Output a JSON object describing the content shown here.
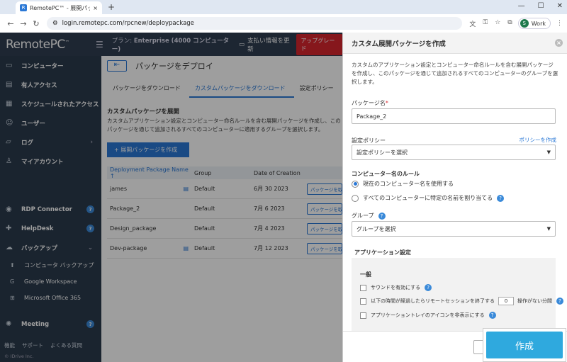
{
  "browser": {
    "tab_title": "RemotePC™ - 展開パッケージ",
    "new_tab": "+",
    "url_host": "login.remotepc.com",
    "url_path": "/rpcnew/deploypackage",
    "profile_initial": "S",
    "profile_label": "Work"
  },
  "topbar": {
    "logo": "RemotePC",
    "logo_tm": "™",
    "plan_label": "プラン: ",
    "plan_value": "Enterprise (4000 コンピューター)",
    "billing_label": "支払い情報を更新",
    "upgrade_label": "アップグレード"
  },
  "sidebar": {
    "items": [
      {
        "label": "コンピューター",
        "icon": "monitor-icon"
      },
      {
        "label": "有人アクセス",
        "icon": "attended-icon"
      },
      {
        "label": "スケジュールされたアクセス",
        "icon": "calendar-icon"
      },
      {
        "label": "ユーザー",
        "icon": "users-icon"
      },
      {
        "label": "ログ",
        "icon": "folder-icon"
      },
      {
        "label": "マイアカウント",
        "icon": "user-icon"
      }
    ],
    "products": [
      {
        "label": "RDP Connector"
      },
      {
        "label": "HelpDesk"
      },
      {
        "label": "バックアップ"
      }
    ],
    "backup_sub": [
      {
        "label": "コンピュータ バックアップ"
      },
      {
        "label": "Google Workspace"
      },
      {
        "label": "Microsoft Office 365"
      }
    ],
    "meeting": "Meeting",
    "footer": [
      "機能",
      "サポート",
      "よくある質問"
    ],
    "copyright": "© IDrive Inc."
  },
  "main": {
    "back_arrow": "⇤",
    "title": "パッケージをデプロイ",
    "tabs": [
      "パッケージをダウンロード",
      "カスタムパッケージをダウンロード",
      "設定ポリシー"
    ],
    "section_title": "カスタムパッケージを展開",
    "section_desc": "カスタムアプリケーション設定とコンピューター命名ルールを含む展開パッケージを作成し、このパッケージを通じて追加されるすべてのコンピューターに適用するグループを選択します。",
    "create_button": "+ 展開パッケージを作成",
    "columns": [
      "Deployment Package Name ↑",
      "Group",
      "Date of Creation"
    ],
    "rows": [
      {
        "name": "james",
        "group": "Default",
        "date": "6月 30 2023",
        "action": "パッケージを取得"
      },
      {
        "name": "Package_2",
        "group": "Default",
        "date": "7月 6 2023",
        "action": "パッケージを取得"
      },
      {
        "name": "Design_package",
        "group": "Default",
        "date": "7月 4 2023",
        "action": "パッケージを取得"
      },
      {
        "name": "Dev-package",
        "group": "Default",
        "date": "7月 12 2023",
        "action": "パッケージを取得"
      }
    ]
  },
  "panel": {
    "title": "カスタム展開パッケージを作成",
    "description": "カスタムのアプリケーション設定とコンピューター命名ルールを含む展開パッケージを作成し、このパッケージを通じて追加されるすべてのコンピューターのグループを選択します。",
    "package_name_label": "パッケージ名",
    "package_name_value": "Package_2",
    "policy_label": "設定ポリシー",
    "policy_create_link": "ポリシーを作成",
    "policy_select": "設定ポリシーを選択",
    "naming_label": "コンピューター名のルール",
    "naming_opt1": "現在のコンピューター名を使用する",
    "naming_opt2": "すべてのコンピューターに特定の名前を割り当てる",
    "group_label": "グループ",
    "group_select": "グループを選択",
    "app_settings_label": "アプリケーション設定",
    "general_label": "一般",
    "sound_label": "サウンドを有効にする",
    "timeout_label": "以下の時間が経過したらリモートセッションを終了する",
    "timeout_value": "0",
    "timeout_suffix": "操作がない分間",
    "tray_label": "アプリケーショントレイのアイコンを非表示にする",
    "create_button": "作成"
  }
}
